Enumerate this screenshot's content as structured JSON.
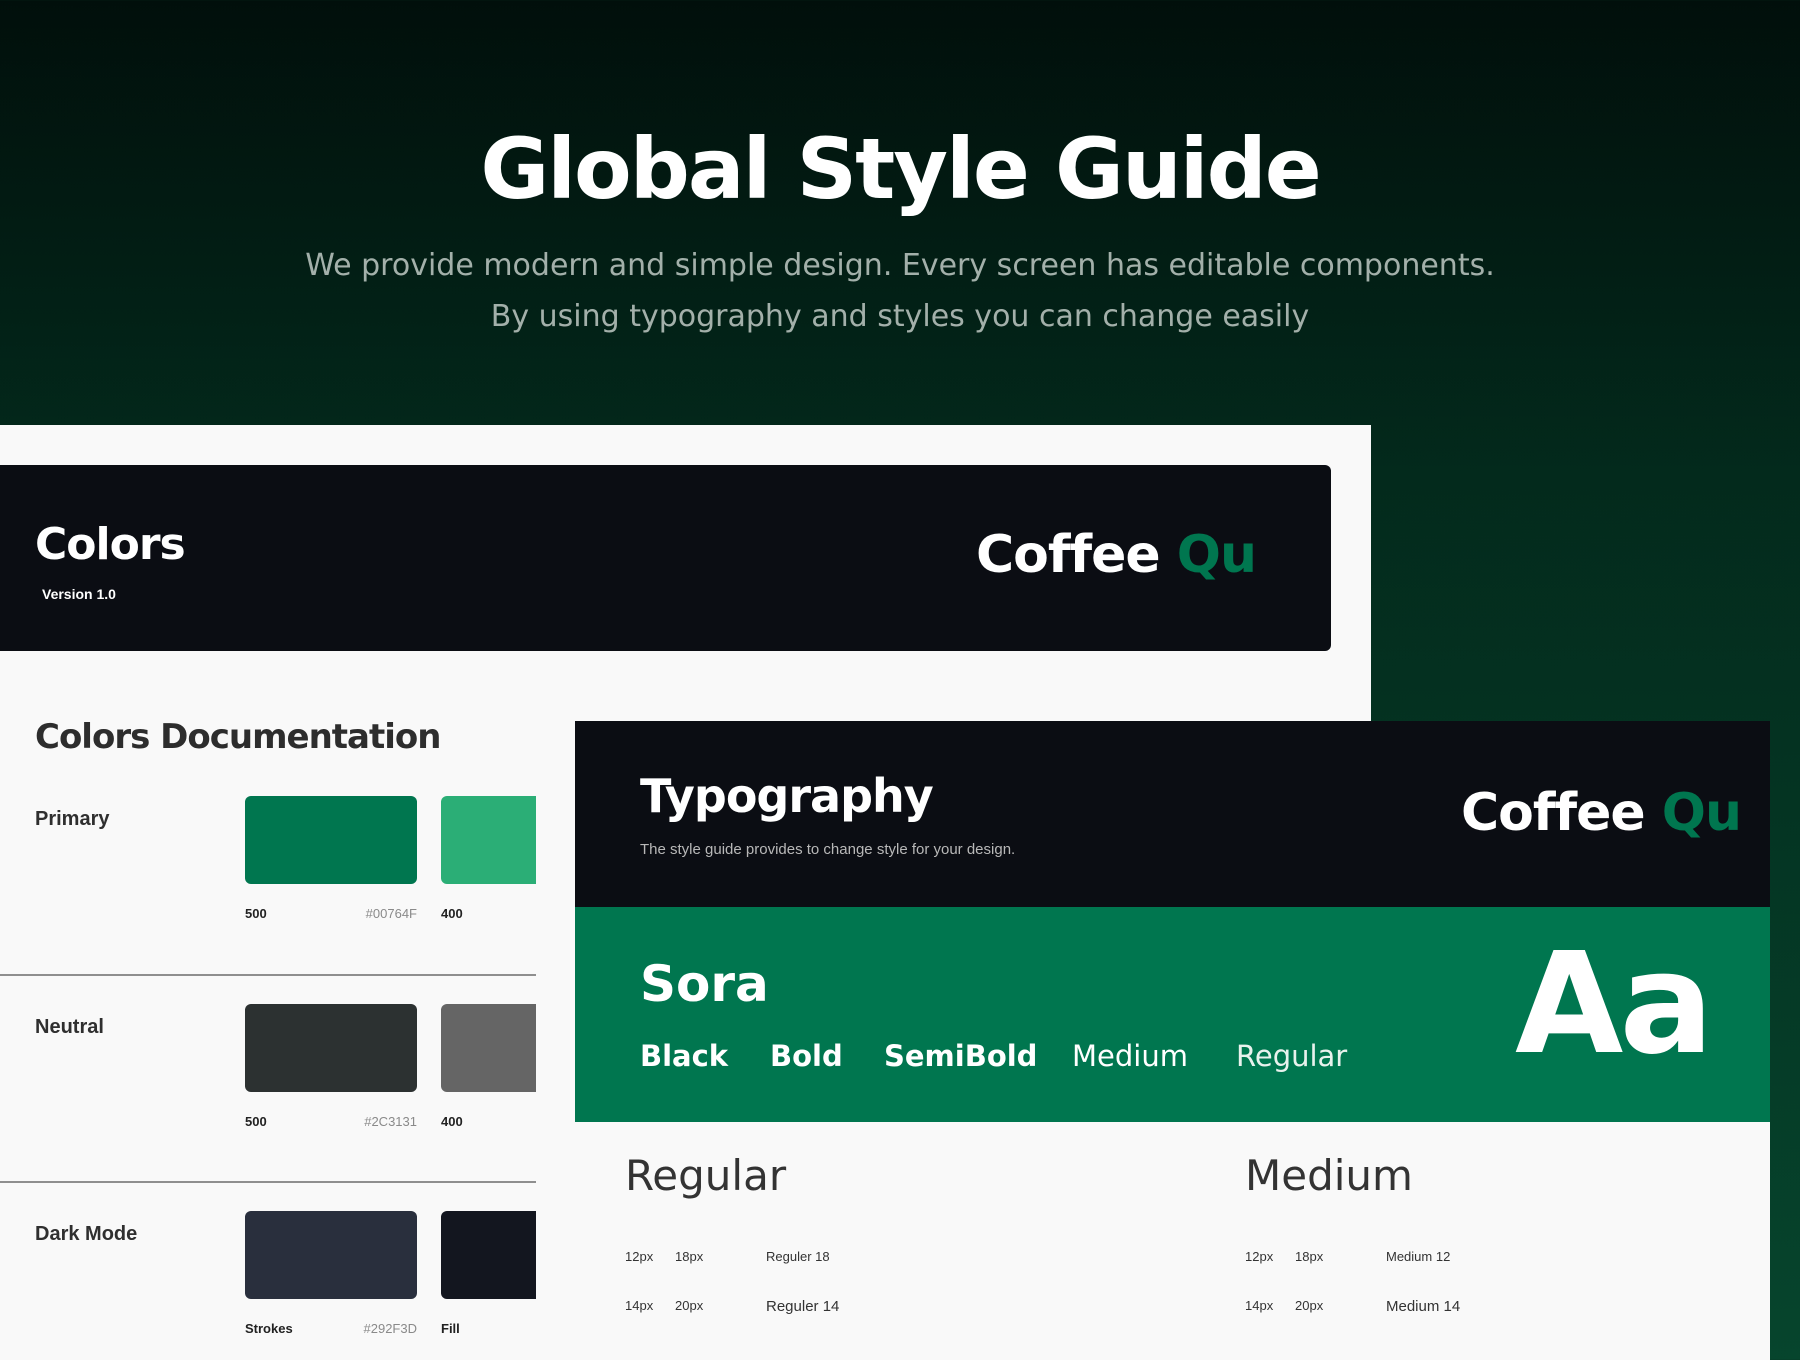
{
  "hero": {
    "title": "Global Style Guide",
    "subtitle_line1": "We provide modern and simple design. Every screen has editable components.",
    "subtitle_line2": "By using typography and styles you can change easily"
  },
  "brand": {
    "part1": "Coffee",
    "part2": "Qu"
  },
  "colors": {
    "title": "Colors",
    "version": "Version 1.0",
    "doc_title": "Colors Documentation",
    "rows": [
      {
        "label": "Primary",
        "swatch1": {
          "color": "#00764F",
          "shade": "500",
          "hex": "#00764F"
        },
        "swatch2": {
          "color": "#2BAE76",
          "shade": "400"
        }
      },
      {
        "label": "Neutral",
        "swatch1": {
          "color": "#2C3131",
          "shade": "500",
          "hex": "#2C3131"
        },
        "swatch2": {
          "color": "#656565",
          "shade": "400"
        }
      },
      {
        "label": "Dark Mode",
        "swatch1": {
          "color": "#292F3D",
          "shade": "Strokes",
          "hex": "#292F3D"
        },
        "swatch2": {
          "color": "#13161F",
          "shade": "Fill"
        }
      }
    ]
  },
  "typography": {
    "title": "Typography",
    "description": "The style guide provides to change style for your design.",
    "font_name": "Sora",
    "sample": "Aa",
    "weights": [
      "Black",
      "Bold",
      "SemiBold",
      "Medium",
      "Regular"
    ],
    "specs": [
      {
        "title": "Regular",
        "rows": [
          {
            "size": "12px",
            "line_height": "18px",
            "name": "Reguler 18"
          },
          {
            "size": "14px",
            "line_height": "20px",
            "name": "Reguler 14"
          }
        ]
      },
      {
        "title": "Medium",
        "rows": [
          {
            "size": "12px",
            "line_height": "18px",
            "name": "Medium 12"
          },
          {
            "size": "14px",
            "line_height": "20px",
            "name": "Medium 14"
          }
        ]
      }
    ]
  },
  "theme": {
    "accent": "#00764F",
    "dark": "#0B0D13",
    "surface": "#F9F9F9"
  }
}
